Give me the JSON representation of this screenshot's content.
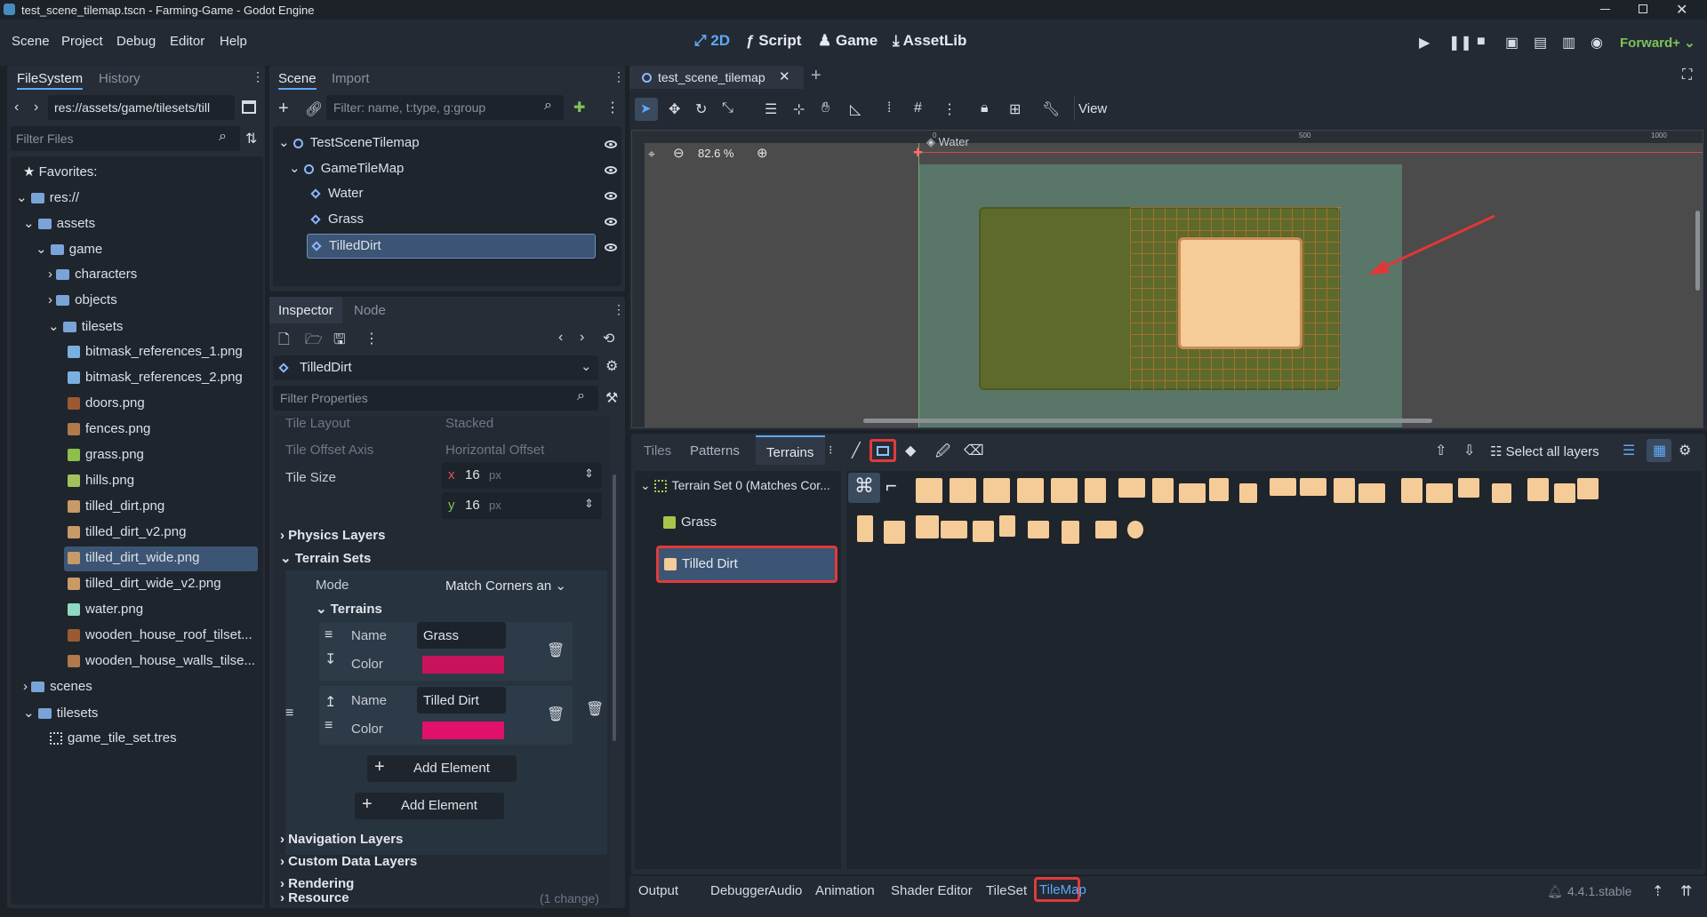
{
  "window": {
    "title": "test_scene_tilemap.tscn - Farming-Game - Godot Engine"
  },
  "menu": {
    "items": [
      "Scene",
      "Project",
      "Debug",
      "Editor",
      "Help"
    ]
  },
  "workspaces": {
    "items": [
      "2D",
      "Script",
      "Game",
      "AssetLib"
    ],
    "active": "2D"
  },
  "renderer": "Forward+",
  "filesystem": {
    "tabs": [
      "FileSystem",
      "History"
    ],
    "path": "res://assets/game/tilesets/till",
    "filter_placeholder": "Filter Files",
    "favorites_label": "Favorites:",
    "tree": [
      {
        "label": "res://",
        "type": "folder"
      },
      {
        "label": "assets",
        "type": "folder"
      },
      {
        "label": "game",
        "type": "folder"
      },
      {
        "label": "characters",
        "type": "folder"
      },
      {
        "label": "objects",
        "type": "folder"
      },
      {
        "label": "tilesets",
        "type": "folder"
      },
      {
        "label": "bitmask_references_1.png",
        "type": "file"
      },
      {
        "label": "bitmask_references_2.png",
        "type": "file"
      },
      {
        "label": "doors.png",
        "type": "file"
      },
      {
        "label": "fences.png",
        "type": "file"
      },
      {
        "label": "grass.png",
        "type": "file"
      },
      {
        "label": "hills.png",
        "type": "file"
      },
      {
        "label": "tilled_dirt.png",
        "type": "file"
      },
      {
        "label": "tilled_dirt_v2.png",
        "type": "file"
      },
      {
        "label": "tilled_dirt_wide.png",
        "type": "file",
        "selected": true
      },
      {
        "label": "tilled_dirt_wide_v2.png",
        "type": "file"
      },
      {
        "label": "water.png",
        "type": "file"
      },
      {
        "label": "wooden_house_roof_tilset...",
        "type": "file"
      },
      {
        "label": "wooden_house_walls_tilse...",
        "type": "file"
      },
      {
        "label": "scenes",
        "type": "folder"
      },
      {
        "label": "tilesets",
        "type": "folder"
      },
      {
        "label": "game_tile_set.tres",
        "type": "file"
      }
    ]
  },
  "scene": {
    "tabs": [
      "Scene",
      "Import"
    ],
    "filter_placeholder": "Filter: name, t:type, g:group",
    "nodes": [
      "TestSceneTilemap",
      "GameTileMap",
      "Water",
      "Grass",
      "TilledDirt"
    ],
    "selected": "TilledDirt"
  },
  "inspector": {
    "tabs": [
      "Inspector",
      "Node"
    ],
    "object": "TilledDirt",
    "filter_placeholder": "Filter Properties",
    "props": {
      "tile_layout": {
        "label": "Tile Layout",
        "value": "Stacked"
      },
      "tile_offset_axis": {
        "label": "Tile Offset Axis",
        "value": "Horizontal Offset"
      },
      "tile_size": {
        "label": "Tile Size",
        "x": "16",
        "y": "16",
        "unit": "px",
        "x_label": "x",
        "y_label": "y"
      }
    },
    "sections": {
      "physics": "Physics Layers",
      "terrain_sets": "Terrain Sets",
      "navigation": "Navigation Layers",
      "custom_data": "Custom Data Layers",
      "rendering": "Rendering",
      "resource": "Resource"
    },
    "mode": {
      "label": "Mode",
      "value": "Match Corners an"
    },
    "terrains_label": "Terrains",
    "terrains": [
      {
        "name_label": "Name",
        "name": "Grass",
        "color_label": "Color",
        "color": "#c8135a"
      },
      {
        "name_label": "Name",
        "name": "Tilled Dirt",
        "color_label": "Color",
        "color": "#e0116b"
      }
    ],
    "add_element": "Add Element",
    "change_note": "(1 change)"
  },
  "viewport": {
    "tab": "test_scene_tilemap",
    "view_label": "View",
    "zoom": "82.6 %",
    "layer_label": "Water",
    "ruler": [
      "0",
      "500",
      "1000"
    ]
  },
  "tilemap_panel": {
    "tabs": [
      "Tiles",
      "Patterns",
      "Terrains"
    ],
    "active_tab": "Terrains",
    "select_layers": "Select all layers",
    "terrain_set": "Terrain Set 0 (Matches Cor...",
    "terrains": [
      {
        "label": "Grass",
        "color": "#a6c64a"
      },
      {
        "label": "Tilled Dirt",
        "color": "#f5cc97"
      }
    ]
  },
  "bottom_tabs": [
    "Output",
    "Debugger",
    "Audio",
    "Animation",
    "Shader Editor",
    "TileSet",
    "TileMap"
  ],
  "version": "4.4.1.stable"
}
